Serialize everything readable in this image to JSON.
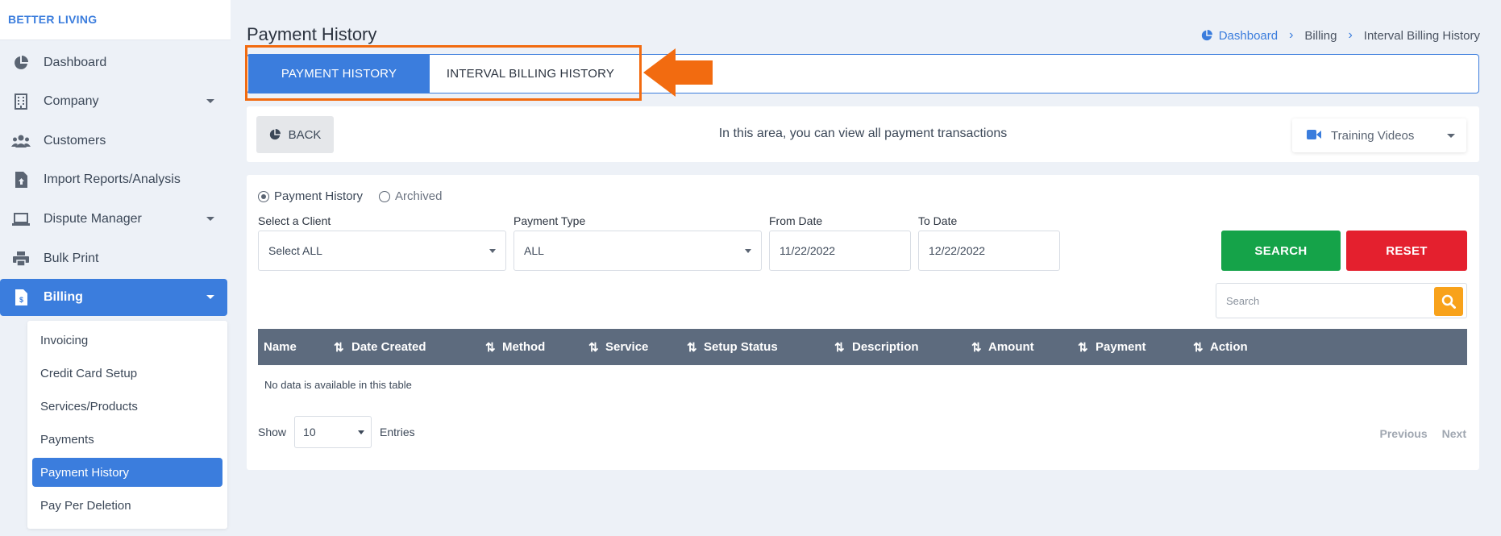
{
  "brand": "BETTER LIVING",
  "colors": {
    "accent": "#3b7ddd",
    "search": "#15a349",
    "reset": "#e4202e",
    "highlight": "#f26b10",
    "table_header": "#5d6b7e",
    "search_icon_bg": "#f8a21b"
  },
  "sidebar": {
    "items": [
      {
        "label": "Dashboard",
        "icon": "pie-chart-icon"
      },
      {
        "label": "Company",
        "icon": "building-icon",
        "has_caret": true
      },
      {
        "label": "Customers",
        "icon": "users-icon"
      },
      {
        "label": "Import Reports/Analysis",
        "icon": "file-upload-icon"
      },
      {
        "label": "Dispute Manager",
        "icon": "laptop-icon",
        "has_caret": true
      },
      {
        "label": "Bulk Print",
        "icon": "printer-icon"
      },
      {
        "label": "Billing",
        "icon": "invoice-icon",
        "has_caret": true,
        "active": true
      }
    ],
    "billing_submenu": [
      {
        "label": "Invoicing"
      },
      {
        "label": "Credit Card Setup"
      },
      {
        "label": "Services/Products"
      },
      {
        "label": "Payments"
      },
      {
        "label": "Payment History",
        "active": true
      },
      {
        "label": "Pay Per Deletion"
      }
    ]
  },
  "header": {
    "title": "Payment History",
    "breadcrumb": [
      "Dashboard",
      "Billing",
      "Interval Billing History"
    ]
  },
  "tabs": [
    {
      "label": "PAYMENT HISTORY",
      "active": true
    },
    {
      "label": "INTERVAL BILLING HISTORY"
    }
  ],
  "info_bar": {
    "back_label": "BACK",
    "text": "In this area, you can view all payment transactions",
    "training_label": "Training Videos"
  },
  "filters": {
    "radios": [
      {
        "label": "Payment History",
        "checked": true
      },
      {
        "label": "Archived",
        "checked": false
      }
    ],
    "client_label": "Select a Client",
    "client_value": "Select ALL",
    "payment_type_label": "Payment Type",
    "payment_type_value": "ALL",
    "from_label": "From Date",
    "from_value": "11/22/2022",
    "to_label": "To Date",
    "to_value": "12/22/2022",
    "search_button": "SEARCH",
    "reset_button": "RESET",
    "search_placeholder": "Search"
  },
  "table": {
    "columns": [
      "Name",
      "Date Created",
      "Method",
      "Service",
      "Setup Status",
      "Description",
      "Amount",
      "Payment",
      "Action"
    ],
    "empty_text": "No data is available in this table"
  },
  "footer": {
    "show_label": "Show",
    "page_size": "10",
    "entries_label": "Entries",
    "previous": "Previous",
    "next": "Next"
  }
}
